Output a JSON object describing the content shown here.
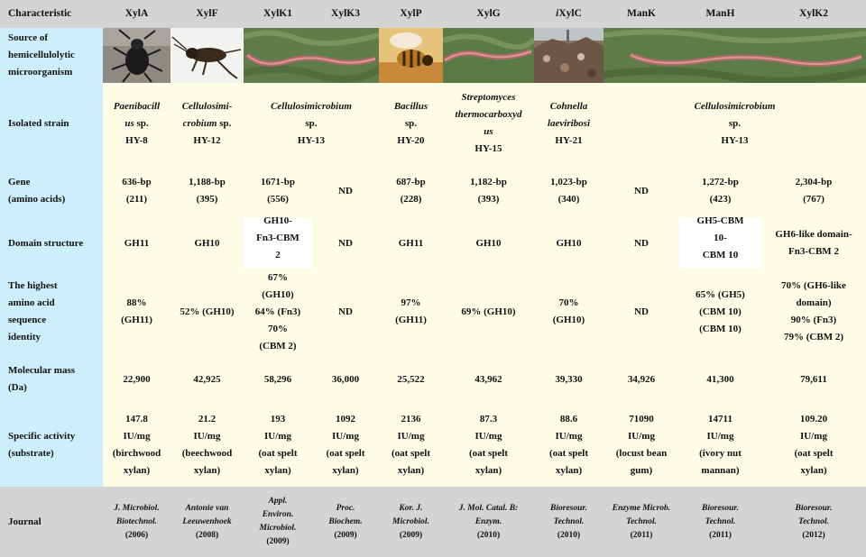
{
  "columns": [
    "Characteristic",
    "XylA",
    "XylF",
    "XylK1",
    "XylK3",
    "XylP",
    "XylG",
    "iXylC",
    "ManK",
    "ManH",
    "XylK2"
  ],
  "rows": {
    "source": {
      "label": "Source of\nhemicellulolytic\nmicroorganism"
    },
    "strain": {
      "label": "Isolated strain",
      "cells": [
        {
          "name": "Paenibacill\nus",
          "suffix": " sp.\nHY-8"
        },
        {
          "name": "Cellulosimi-\ncrobium",
          "suffix": " sp.\nHY-12"
        },
        {
          "name": "Cellulosimicrobium",
          "suffix": "\nsp.\nHY-13"
        },
        {
          "name": "Bacillus",
          "suffix": "\nsp.\nHY-20"
        },
        {
          "name": "Streptomyces\nthermocarboxyd\nus",
          "suffix": "\nHY-15"
        },
        {
          "name": "Cohnella\nlaeviribosi",
          "suffix": "\nHY-21"
        },
        {
          "name": "Cellulosimicrobium",
          "suffix": "\nsp.\nHY-13"
        }
      ]
    },
    "gene": {
      "label": "Gene\n(amino acids)",
      "values": [
        "636-bp\n(211)",
        "1,188-bp\n(395)",
        "1671-bp\n(556)",
        "ND",
        "687-bp\n(228)",
        "1,182-bp\n(393)",
        "1,023-bp\n(340)",
        "ND",
        "1,272-bp\n(423)",
        "2,304-bp\n(767)"
      ]
    },
    "domain": {
      "label": "Domain structure",
      "values": [
        "GH11",
        "GH10",
        "GH10-\nFn3-CBM\n2",
        "ND",
        "GH11",
        "GH10",
        "GH10",
        "ND",
        "GH5-CBM\n10-\nCBM 10",
        "GH6-like domain-\nFn3-CBM 2"
      ]
    },
    "identity": {
      "label": "The highest\namino acid\nsequence\nidentity",
      "values": [
        "88%\n(GH11)",
        "52% (GH10)",
        "67%\n(GH10)\n64% (Fn3)\n70%\n(CBM 2)",
        "ND",
        "97%\n(GH11)",
        "69% (GH10)",
        "70%\n(GH10)",
        "ND",
        "65% (GH5)\n(CBM 10)\n(CBM 10)",
        "70% (GH6-like\ndomain)\n90% (Fn3)\n79% (CBM 2)"
      ]
    },
    "mass": {
      "label": "Molecular mass\n(Da)",
      "values": [
        "22,900",
        "42,925",
        "58,296",
        "36,000",
        "25,522",
        "43,962",
        "39,330",
        "34,926",
        "41,300",
        "79,611"
      ]
    },
    "activity": {
      "label": "Specific activity\n(substrate)",
      "values": [
        "147.8\nIU/mg\n(birchwood\nxylan)",
        "21.2\nIU/mg\n(beechwood\nxylan)",
        "193\nIU/mg\n(oat spelt\nxylan)",
        "1092\nIU/mg\n(oat spelt\nxylan)",
        "2136\nIU/mg\n(oat spelt\nxylan)",
        "87.3\nIU/mg\n(oat spelt\nxylan)",
        "88.6\nIU/mg\n(oat spelt\nxylan)",
        "71090\nIU/mg\n(locust bean\ngum)",
        "14711\nIU/mg\n(ivory nut\nmannan)",
        "109.20\nIU/mg\n(oat spelt\nxylan)"
      ]
    },
    "journal": {
      "label": "Journal",
      "cells": [
        {
          "name": "J. Microbiol.\nBiotechnol.",
          "year": "(2006)"
        },
        {
          "name": "Antonie van\nLeeuwenhoek",
          "year": "(2008)"
        },
        {
          "name": "Appl.\nEnviron.\nMicrobiol.",
          "year": "(2009)"
        },
        {
          "name": "Proc.\nBiochem.",
          "year": "(2009)"
        },
        {
          "name": "Kor. J.\nMicrobiol.",
          "year": "(2009)"
        },
        {
          "name": "J. Mol. Catal. B:\nEnzym.",
          "year": "(2010)"
        },
        {
          "name": "Bioresour.\nTechnol.",
          "year": "(2010)"
        },
        {
          "name": "Enzyme Microb.\nTechnol.",
          "year": "(2011)"
        },
        {
          "name": "Bioresour.\nTechnol.",
          "year": "(2011)"
        },
        {
          "name": "Bioresour.\nTechnol.",
          "year": "(2012)"
        }
      ]
    }
  },
  "images": [
    {
      "icon": "beetle-photo"
    },
    {
      "icon": "cricket-photo"
    },
    {
      "icon": "earthworm-photo"
    },
    {
      "icon": "bee-photo"
    },
    {
      "icon": "earthworm-photo"
    },
    {
      "icon": "compost-photo"
    },
    {
      "icon": "earthworm-photo"
    }
  ],
  "colors": {
    "header_bg": "#d4d4d4",
    "label_bg": "#cdeffc",
    "body_bg": "#fdfde6",
    "journal_bg": "#d4d4d4"
  }
}
